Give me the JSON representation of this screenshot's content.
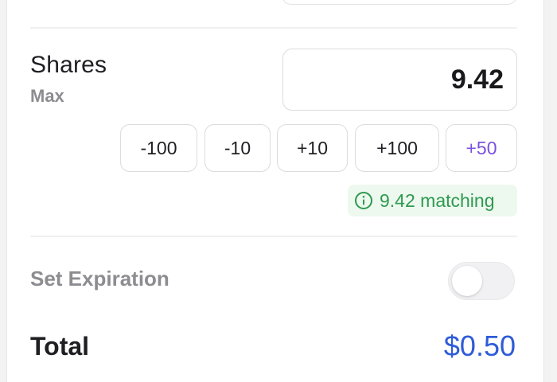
{
  "shares": {
    "label": "Shares",
    "max_label": "Max",
    "value": "9.42"
  },
  "steppers": [
    {
      "label": "-100"
    },
    {
      "label": "-10"
    },
    {
      "label": "+10"
    },
    {
      "label": "+100"
    },
    {
      "label": "+50"
    }
  ],
  "match": {
    "text": "9.42 matching",
    "icon": "info-icon",
    "color": "#2f9a4f"
  },
  "expiration": {
    "label": "Set Expiration",
    "enabled": false
  },
  "total": {
    "label": "Total",
    "value": "$0.50"
  },
  "colors": {
    "accent_purple": "#7b4fe0",
    "total_blue": "#2e5bd8",
    "match_green": "#2f9a4f"
  }
}
